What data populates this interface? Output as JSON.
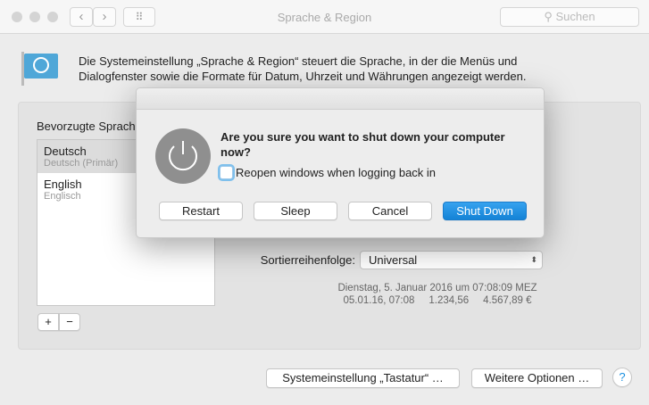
{
  "window": {
    "title": "Sprache & Region",
    "search_placeholder": "Suchen",
    "back": "‹",
    "forward": "›",
    "grid": "⠿"
  },
  "intro": "Die Systemeinstellung „Sprache & Region“ steuert die Sprache, in der die Menüs und Dialogfenster sowie die Formate für Datum, Uhrzeit und Währungen angezeigt werden.",
  "languages": {
    "label": "Bevorzugte Sprachen:",
    "items": [
      {
        "name": "Deutsch",
        "sub": "Deutsch (Primär)"
      },
      {
        "name": "English",
        "sub": "Englisch"
      }
    ],
    "add": "+",
    "remove": "−"
  },
  "sort": {
    "label": "Sortierreihenfolge:",
    "value": "Universal"
  },
  "preview": {
    "line1": "Dienstag, 5. Januar 2016 um 07:08:09 MEZ",
    "date": "05.01.16, 07:08",
    "number": "1.234,56",
    "currency": "4.567,89 €"
  },
  "footer": {
    "keyboard": "Systemeinstellung „Tastatur“ …",
    "more": "Weitere Optionen …",
    "help": "?"
  },
  "dialog": {
    "message": "Are you sure you want to shut down your computer now?",
    "checkbox": "Reopen windows when logging back in",
    "checked": false,
    "buttons": {
      "restart": "Restart",
      "sleep": "Sleep",
      "cancel": "Cancel",
      "shutdown": "Shut Down"
    }
  },
  "colors": {
    "accent": "#1a8fe0"
  }
}
